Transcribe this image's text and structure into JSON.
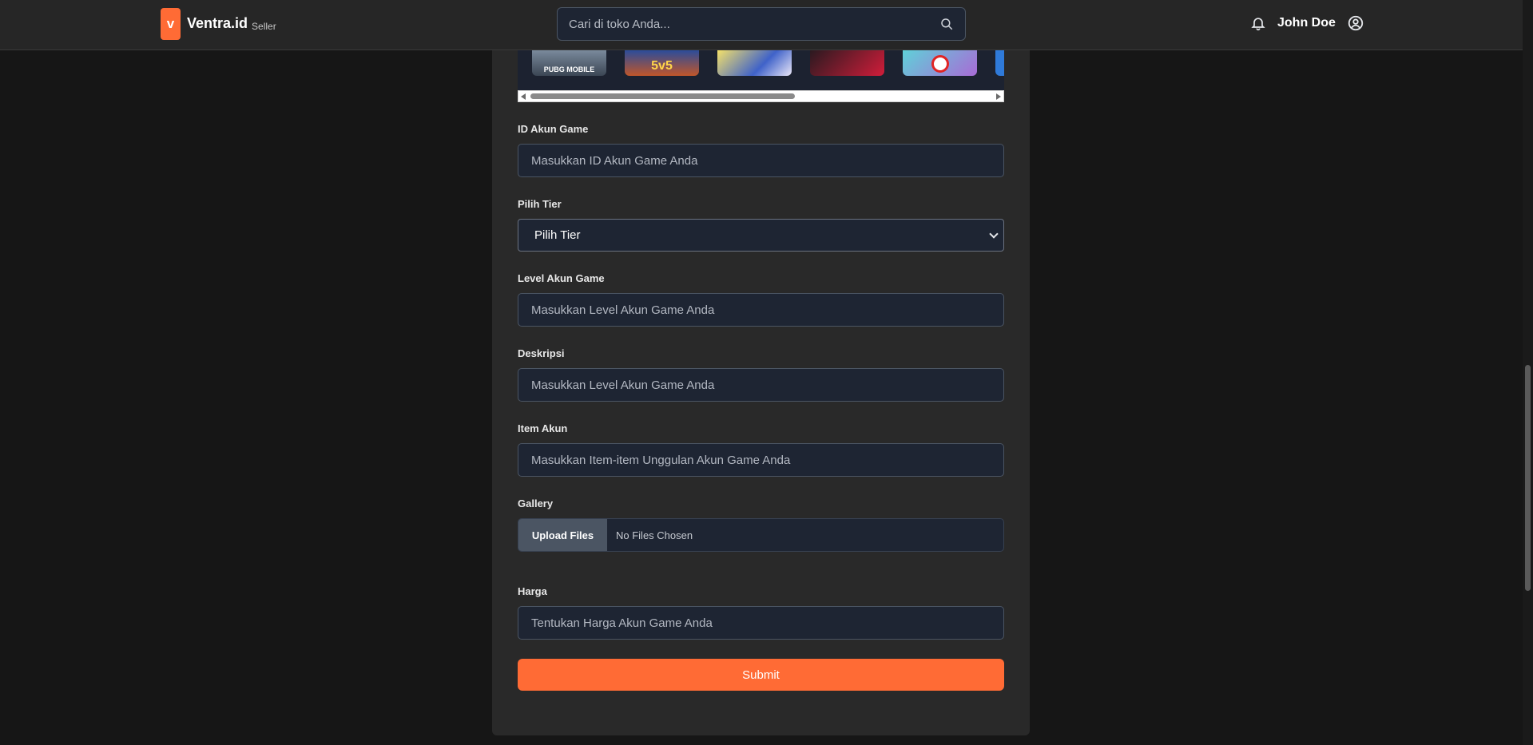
{
  "header": {
    "brand_letter": "v",
    "brand_name": "Ventra.id",
    "brand_sub": "Seller",
    "search_placeholder": "Cari di toko Anda...",
    "user_name": "John Doe",
    "accent": "#ff6b35"
  },
  "carousel": {
    "games": [
      {
        "label": "PUBG MOBILE",
        "icon": "pubg-thumbnail"
      },
      {
        "label": "5v5",
        "icon": "mobile-legends-thumbnail"
      },
      {
        "label": "",
        "icon": "genshin-thumbnail"
      },
      {
        "label": "",
        "icon": "valorant-thumbnail"
      },
      {
        "label": "",
        "icon": "free-fire-thumbnail"
      },
      {
        "label": "",
        "icon": "game-thumbnail"
      }
    ]
  },
  "form": {
    "id_label": "ID Akun Game",
    "id_placeholder": "Masukkan ID Akun Game Anda",
    "tier_label": "Pilih Tier",
    "tier_value": "Pilih Tier",
    "level_label": "Level Akun Game",
    "level_placeholder": "Masukkan Level Akun Game Anda",
    "desc_label": "Deskripsi",
    "desc_placeholder": "Masukkan Level Akun Game Anda",
    "item_label": "Item Akun",
    "item_placeholder": "Masukkan Item-item Unggulan Akun Game Anda",
    "gallery_label": "Gallery",
    "upload_button": "Upload Files",
    "upload_status": "No Files Chosen",
    "price_label": "Harga",
    "price_placeholder": "Tentukan Harga Akun Game Anda",
    "submit_label": "Submit"
  }
}
